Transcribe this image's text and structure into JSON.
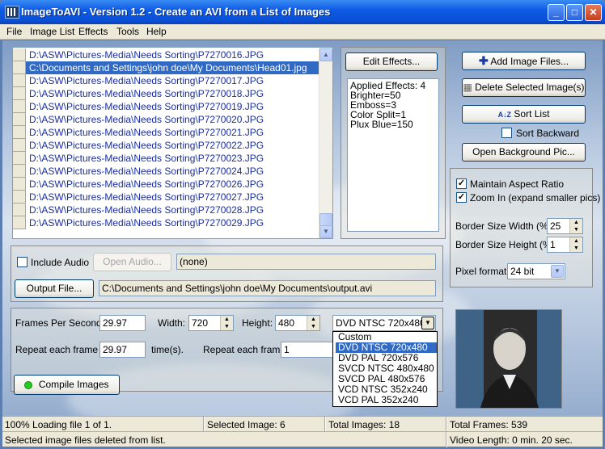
{
  "window": {
    "title": "ImageToAVI - Version 1.2 - Create an AVI from a List of Images"
  },
  "menu": [
    "File",
    "Image List",
    "Effects",
    "Tools",
    "Help"
  ],
  "files": [
    "D:\\ASW\\Pictures-Media\\Needs Sorting\\P7270016.JPG",
    "C:\\Documents and Settings\\john doe\\My Documents\\Head01.jpg",
    "D:\\ASW\\Pictures-Media\\Needs Sorting\\P7270017.JPG",
    "D:\\ASW\\Pictures-Media\\Needs Sorting\\P7270018.JPG",
    "D:\\ASW\\Pictures-Media\\Needs Sorting\\P7270019.JPG",
    "D:\\ASW\\Pictures-Media\\Needs Sorting\\P7270020.JPG",
    "D:\\ASW\\Pictures-Media\\Needs Sorting\\P7270021.JPG",
    "D:\\ASW\\Pictures-Media\\Needs Sorting\\P7270022.JPG",
    "D:\\ASW\\Pictures-Media\\Needs Sorting\\P7270023.JPG",
    "D:\\ASW\\Pictures-Media\\Needs Sorting\\P7270024.JPG",
    "D:\\ASW\\Pictures-Media\\Needs Sorting\\P7270026.JPG",
    "D:\\ASW\\Pictures-Media\\Needs Sorting\\P7270027.JPG",
    "D:\\ASW\\Pictures-Media\\Needs Sorting\\P7270028.JPG",
    "D:\\ASW\\Pictures-Media\\Needs Sorting\\P7270029.JPG"
  ],
  "selected_file_index": 1,
  "effects": {
    "edit_button": "Edit Effects...",
    "applied": [
      "Applied Effects: 4",
      "Brighter=50",
      "Emboss=3",
      "Color Split=1",
      "Plux Blue=150"
    ]
  },
  "actions": {
    "add_images": "Add Image Files...",
    "delete_selected": "Delete Selected Image(s)",
    "sort_list": "Sort List",
    "sort_backward": "Sort Backward",
    "sort_backward_checked": false,
    "open_background": "Open Background Pic..."
  },
  "options": {
    "maintain_aspect": "Maintain Aspect Ratio",
    "maintain_aspect_checked": true,
    "zoom_in": "Zoom In (expand smaller pics)",
    "zoom_in_checked": true,
    "border_width_label": "Border Size Width (%):",
    "border_width_value": "25",
    "border_height_label": "Border Size Height (%):",
    "border_height_value": "1",
    "pixel_format_label": "Pixel format:",
    "pixel_format_value": "24 bit"
  },
  "audio": {
    "include_label": "Include Audio",
    "include_checked": false,
    "open_button": "Open Audio...",
    "path": "(none)"
  },
  "output": {
    "button": "Output File...",
    "path": "C:\\Documents and Settings\\john doe\\My Documents\\output.avi"
  },
  "video": {
    "fps_label": "Frames Per Second:",
    "fps_value": "29.97",
    "width_label": "Width:",
    "width_value": "720",
    "height_label": "Height:",
    "height_value": "480",
    "repeat_label": "Repeat each frame",
    "repeat_value": "29.97",
    "times_label": "time(s).",
    "repeat2_label": "Repeat each frame",
    "repeat2_value": "1",
    "preset_value": "DVD NTSC 720x480",
    "preset_options": [
      "Custom",
      "DVD NTSC 720x480",
      "DVD PAL 720x576",
      "SVCD NTSC 480x480",
      "SVCD PAL 480x576",
      "VCD NTSC 352x240",
      "VCD PAL 352x240"
    ],
    "preset_selected_index": 1
  },
  "compile_button": "Compile Images",
  "status": {
    "loading": "100% Loading file 1 of 1.",
    "selected_image": "Selected Image: 6",
    "total_images": "Total Images: 18",
    "total_frames": "Total Frames: 539",
    "message": "Selected image files deleted from list.",
    "video_length": "Video Length: 0 min. 20 sec."
  },
  "colors": {
    "title_blue": "#0a4fd6",
    "selection": "#316ac5",
    "file_text": "#1a2ea0",
    "compile_led": "#22cc22"
  }
}
